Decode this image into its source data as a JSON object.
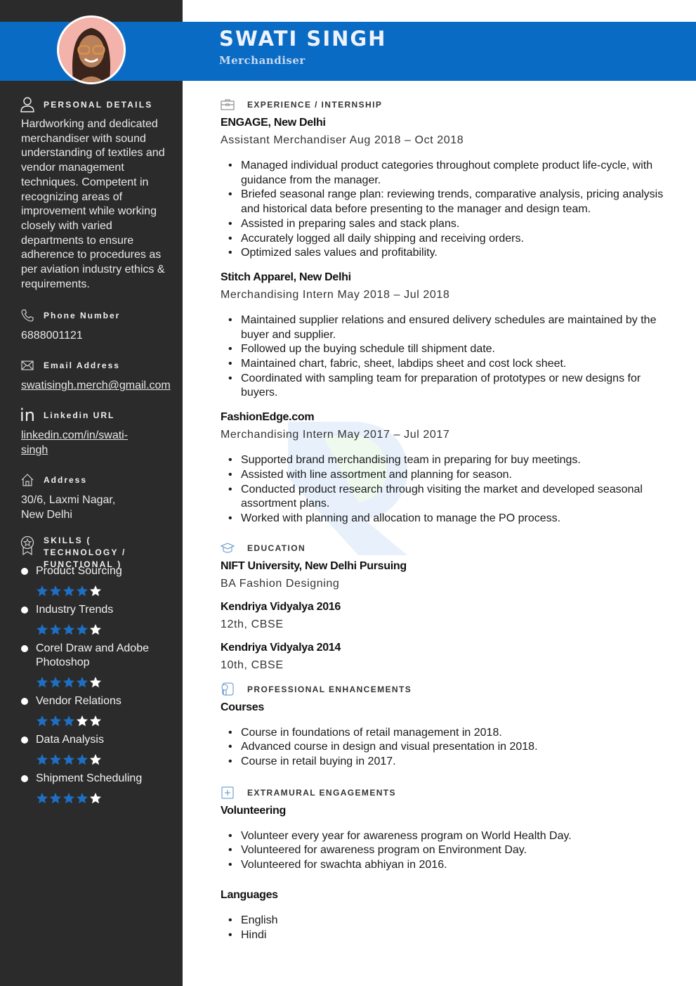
{
  "header": {
    "name": "SWATI SINGH",
    "title": "Merchandiser"
  },
  "colors": {
    "accent": "#0a6bc4",
    "sidebar": "#2b2b2b",
    "star_filled": "#1e6fc4",
    "star_empty": "#ffffff"
  },
  "sidebar": {
    "personal": {
      "heading": "PERSONAL DETAILS",
      "icon": "user-icon",
      "summary": "Hardworking and dedicated merchandiser with sound understanding of textiles and vendor management techniques. Competent in recognizing areas of improvement while working closely with varied departments to ensure adherence to procedures as per aviation industry ethics & requirements."
    },
    "phone": {
      "label": "Phone Number",
      "icon": "phone-icon",
      "value": "6888001121"
    },
    "email": {
      "label": "Email Address",
      "icon": "envelope-icon",
      "value": "swatisingh.merch@gmail.com"
    },
    "linkedin": {
      "label": "Linkedin URL",
      "icon": "linkedin-icon",
      "value": "linkedin.com/in/swati-singh"
    },
    "address": {
      "label": "Address",
      "icon": "home-icon",
      "value": "30/6, Laxmi Nagar, New Delhi"
    },
    "skills": {
      "heading": "SKILLS ( TECHNOLOGY / FUNCTIONAL )",
      "icon": "award-icon",
      "max_rating": 5,
      "items": [
        {
          "name": "Product Sourcing",
          "rating": 4
        },
        {
          "name": "Industry Trends",
          "rating": 4
        },
        {
          "name": "Corel Draw and Adobe Photoshop",
          "rating": 4
        },
        {
          "name": "Vendor Relations",
          "rating": 3
        },
        {
          "name": "Data Analysis",
          "rating": 4
        },
        {
          "name": "Shipment Scheduling",
          "rating": 4
        }
      ]
    }
  },
  "main": {
    "experience": {
      "heading": "EXPERIENCE / INTERNSHIP",
      "icon": "briefcase-icon",
      "jobs": [
        {
          "org": "ENGAGE, New Delhi",
          "role": "Assistant Merchandiser Aug 2018 – Oct 2018",
          "bullets": [
            "Managed individual product categories throughout complete product life-cycle, with guidance from the manager.",
            "Briefed seasonal range plan: reviewing trends, comparative analysis, pricing analysis and historical data before presenting to the manager and design team.",
            "Assisted in preparing sales and stack plans.",
            "Accurately logged all daily shipping and receiving orders.",
            "Optimized sales values and profitability."
          ]
        },
        {
          "org": "Stitch Apparel, New Delhi",
          "role": "Merchandising Intern May 2018 – Jul 2018",
          "bullets": [
            "Maintained supplier relations and ensured delivery schedules are maintained by the buyer and supplier.",
            "Followed up the buying schedule till shipment date.",
            "Maintained chart, fabric, sheet, labdips sheet and cost lock sheet.",
            "Coordinated with sampling team for preparation of prototypes or new designs for buyers."
          ]
        },
        {
          "org": "FashionEdge.com",
          "role": "Merchandising Intern May 2017 – Jul 2017",
          "bullets": [
            "Supported brand merchandising team in preparing for buy meetings.",
            "Assisted with line assortment and planning for season.",
            "Conducted product research through visiting the market and developed seasonal assortment plans.",
            "Worked with planning and allocation to manage the PO process."
          ]
        }
      ]
    },
    "education": {
      "heading": "EDUCATION",
      "icon": "graduation-cap-icon",
      "items": [
        {
          "school": "NIFT University, New Delhi Pursuing",
          "detail": "BA Fashion Designing"
        },
        {
          "school": "Kendriya Vidyalya 2016",
          "detail": "12th, CBSE"
        },
        {
          "school": "Kendriya Vidyalya 2014",
          "detail": "10th, CBSE"
        }
      ]
    },
    "professional": {
      "heading": "PROFESSIONAL ENHANCEMENTS",
      "icon": "certificate-icon",
      "subheading": "Courses",
      "bullets": [
        "Course in foundations of retail management in 2018.",
        "Advanced course in design and visual presentation in 2018.",
        "Course in retail buying in 2017."
      ]
    },
    "extramural": {
      "heading": "EXTRAMURAL ENGAGEMENTS",
      "icon": "plus-box-icon",
      "volunteering": {
        "subheading": "Volunteering",
        "bullets": [
          "Volunteer every year for awareness program on World Health Day.",
          "Volunteered for awareness program on Environment Day.",
          "Volunteered for swachta abhiyan in 2016."
        ]
      },
      "languages": {
        "subheading": "Languages",
        "bullets": [
          "English",
          "Hindi"
        ]
      }
    }
  }
}
